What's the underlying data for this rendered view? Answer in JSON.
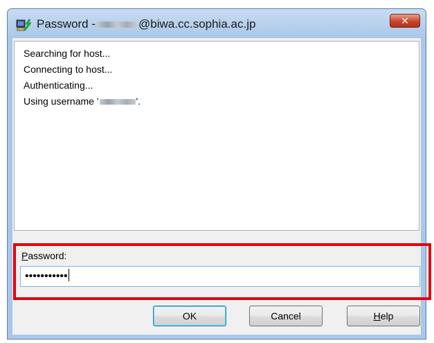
{
  "window": {
    "title_prefix": "Password -",
    "title_suffix": "@biwa.cc.sophia.ac.jp",
    "close_label": "✕"
  },
  "log": {
    "lines": [
      "Searching for host...",
      "Connecting to host...",
      "Authenticating...",
      "Using username '"
    ],
    "username_suffix": "'."
  },
  "password": {
    "label_mnemonic": "P",
    "label_rest": "assword:",
    "value_masked": "•••••••••••"
  },
  "buttons": {
    "ok": "OK",
    "cancel": "Cancel",
    "help_mnemonic": "H",
    "help_rest": "elp"
  }
}
